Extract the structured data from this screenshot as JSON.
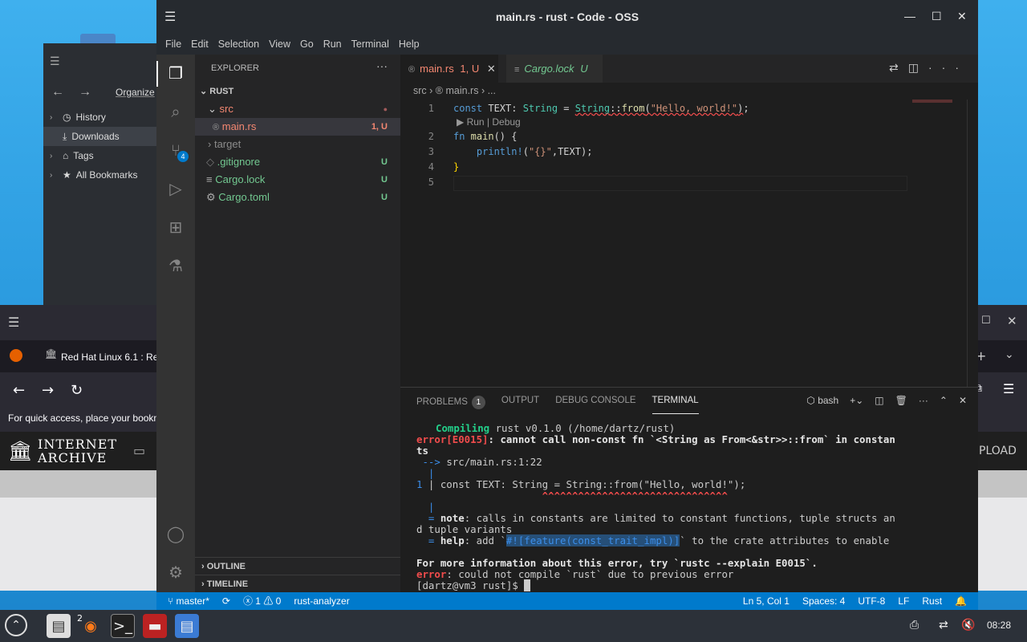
{
  "window": {
    "title": "main.rs - rust - Code - OSS"
  },
  "menu": [
    "File",
    "Edit",
    "Selection",
    "View",
    "Go",
    "Run",
    "Terminal",
    "Help"
  ],
  "explorer": {
    "header": "EXPLORER",
    "root": "RUST",
    "items": [
      {
        "label": "src",
        "status": ""
      },
      {
        "label": "main.rs",
        "status": "1, U"
      },
      {
        "label": "target",
        "status": ""
      },
      {
        "label": ".gitignore",
        "status": "U"
      },
      {
        "label": "Cargo.lock",
        "status": "U"
      },
      {
        "label": "Cargo.toml",
        "status": "U"
      }
    ],
    "outline": "OUTLINE",
    "timeline": "TIMELINE"
  },
  "activity": {
    "scm_badge": "4"
  },
  "tabs": [
    {
      "label": "main.rs",
      "status": "1, U"
    },
    {
      "label": "Cargo.lock",
      "status": "U"
    }
  ],
  "breadcrumb": {
    "folder": "src",
    "file": "main.rs",
    "more": "..."
  },
  "editor": {
    "line_numbers": [
      "1",
      "2",
      "3",
      "4",
      "5"
    ],
    "codelens": "▶ Run | Debug",
    "lines": {
      "l1": {
        "kw": "const",
        "name": " TEXT: ",
        "ty": "String",
        " eq": " = ",
        "call": "String",
        "sep": "::",
        "fn": "from",
        "p1": "(",
        "str": "\"Hello, world!\"",
        "p2": ");"
      },
      "l2": {
        "kw": "fn",
        "name": " main",
        "rest": "() {"
      },
      "l3": {
        "mac": "println!",
        "a": "(",
        "str": "\"{}\"",
        "b": ",TEXT);"
      },
      "l4": {
        "br": "}"
      }
    }
  },
  "panel": {
    "tabs": [
      "PROBLEMS",
      "OUTPUT",
      "DEBUG CONSOLE",
      "TERMINAL"
    ],
    "problems_count": "1",
    "shell": "bash"
  },
  "terminal": {
    "compiling_kw": "Compiling",
    "compiling_rest": " rust v0.1.0 (/home/dartz/rust)",
    "err_code": "error[E0015]",
    "err_msg": ": cannot call non-const fn `<String as From<&str>>::from` in constan",
    "err_wrap": "ts",
    "arrow": " --> ",
    "loc": "src/main.rs:1:22",
    "pipe": "  |",
    "src_no": "1",
    "src_line": " | const TEXT: String = String::from(\"Hello, world!\");",
    "carets": "                     ^^^^^^^^^^^^^^^^^^^^^^^^^^^^^^^",
    "note_kw": "note",
    "note_msg": ": calls in constants are limited to constant functions, tuple structs an",
    "note_wrap": "d tuple variants",
    "help_kw": "help",
    "help_pre": ": add `",
    "help_hl": "#![feature(const_trait_impl)]",
    "help_post": "` to the crate attributes to enable",
    "more_info": "For more information about this error, try `rustc --explain E0015`.",
    "final_err": "error",
    "final_msg": ": could not compile `rust` due to previous error",
    "prompt": "[dartz@vm3 rust]$ "
  },
  "status": {
    "branch": "master*",
    "errors": "1",
    "warnings": "0",
    "lsp": "rust-analyzer",
    "position": "Ln 5, Col 1",
    "spaces": "Spaces: 4",
    "encoding": "UTF-8",
    "eol": "LF",
    "language": "Rust"
  },
  "dolphin": {
    "organize": "Organize",
    "places": [
      "History",
      "Downloads",
      "Tags",
      "All Bookmarks"
    ]
  },
  "firefox": {
    "tab_title": "Red Hat Linux 6.1 : Re",
    "bookmarks_hint": "For quick access, place your bookm",
    "ia_line1": "INTERNET",
    "ia_line2": "ARCHIVE",
    "upload": "PLOAD"
  },
  "taskbar": {
    "clock": "08:28",
    "ff_badge": "2"
  },
  "colors": {
    "accent": "#007acc",
    "error": "#f14c4c",
    "untracked": "#73c991"
  }
}
